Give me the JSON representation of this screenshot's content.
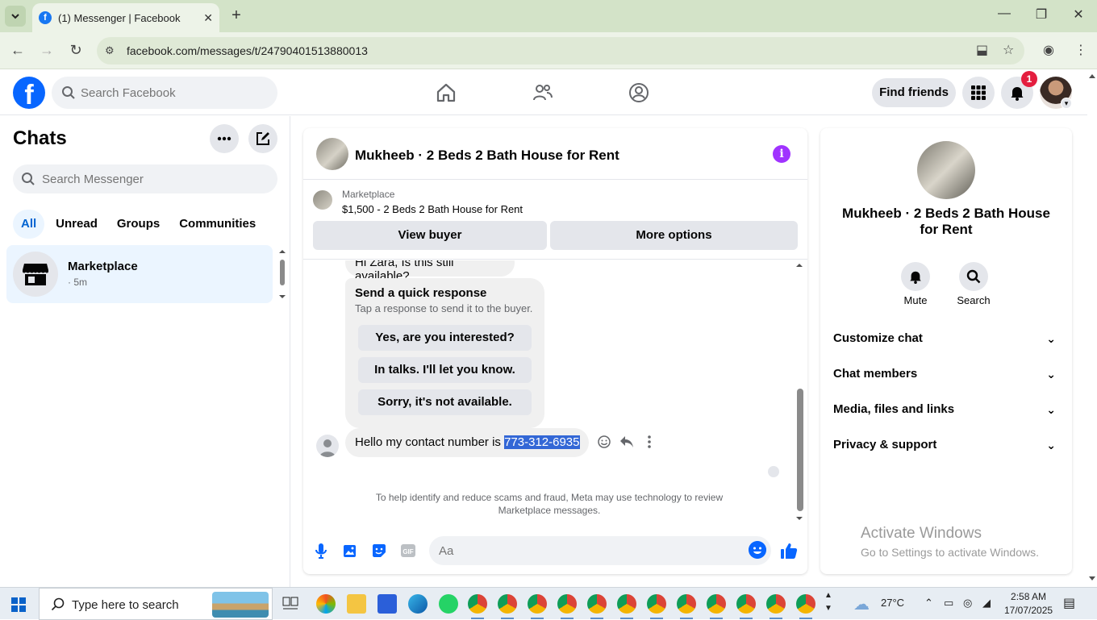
{
  "browser": {
    "tab_title": "(1) Messenger | Facebook",
    "url": "facebook.com/messages/t/24790401513880013"
  },
  "fb_header": {
    "search_placeholder": "Search Facebook",
    "find_friends": "Find friends",
    "notification_count": "1"
  },
  "left": {
    "title": "Chats",
    "search_placeholder": "Search Messenger",
    "filters": [
      "All",
      "Unread",
      "Groups",
      "Communities"
    ],
    "chat": {
      "name": "Marketplace",
      "time": "· 5m"
    }
  },
  "conversation": {
    "name": "Mukheeb · 2 Beds 2 Bath House for Rent",
    "marketplace_label": "Marketplace",
    "listing": "$1,500 - 2 Beds 2 Bath House for Rent",
    "view_buyer": "View buyer",
    "more_options": "More options",
    "first_message": "Hi Zara, Is this still available?",
    "quick_response_title": "Send a quick response",
    "quick_response_sub": "Tap a response to send it to the buyer.",
    "quick_options": [
      "Yes, are you interested?",
      "In talks. I'll let you know.",
      "Sorry, it's not available."
    ],
    "contact_text": "Hello my contact number is ",
    "contact_number": "773-312-6935",
    "notice": "To help identify and reduce scams and fraud, Meta may use technology to review Marketplace messages.",
    "composer_placeholder": "Aa"
  },
  "right": {
    "name": "Mukheeb · 2 Beds 2 Bath House for Rent",
    "mute": "Mute",
    "search": "Search",
    "sections": [
      "Customize chat",
      "Chat members",
      "Media, files and links",
      "Privacy & support"
    ],
    "activate_title": "Activate Windows",
    "activate_sub": "Go to Settings to activate Windows."
  },
  "taskbar": {
    "search_placeholder": "Type here to search",
    "temperature": "27°C",
    "time": "2:58 AM",
    "date": "17/07/2025"
  },
  "colors": {
    "fb_blue": "#0866ff",
    "selection": "#3367d6",
    "info_purple": "#a033ff"
  }
}
